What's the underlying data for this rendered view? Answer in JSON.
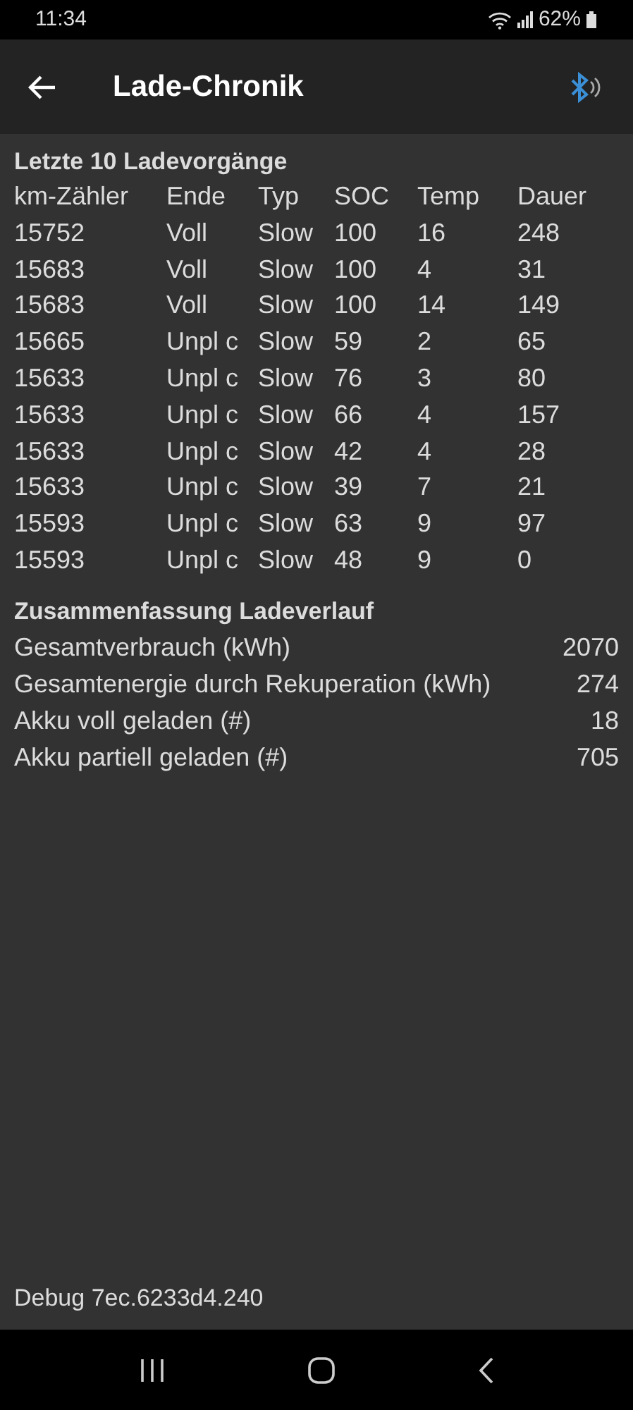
{
  "status_bar": {
    "time": "11:34",
    "battery": "62%"
  },
  "app_bar": {
    "title": "Lade-Chronik"
  },
  "history": {
    "title": "Letzte 10 Ladevorgänge",
    "columns": [
      "km-Zähler",
      "Ende",
      "Typ",
      "SOC",
      "Temp",
      "Dauer"
    ],
    "rows": [
      [
        "15752",
        "Voll",
        "Slow",
        "100",
        "16",
        "248"
      ],
      [
        "15683",
        "Voll",
        "Slow",
        "100",
        "4",
        "31"
      ],
      [
        "15683",
        "Voll",
        "Slow",
        "100",
        "14",
        "149"
      ],
      [
        "15665",
        "Unpl c",
        "Slow",
        "59",
        "2",
        "65"
      ],
      [
        "15633",
        "Unpl c",
        "Slow",
        "76",
        "3",
        "80"
      ],
      [
        "15633",
        "Unpl c",
        "Slow",
        "66",
        "4",
        "157"
      ],
      [
        "15633",
        "Unpl c",
        "Slow",
        "42",
        "4",
        "28"
      ],
      [
        "15633",
        "Unpl c",
        "Slow",
        "39",
        "7",
        "21"
      ],
      [
        "15593",
        "Unpl c",
        "Slow",
        "63",
        "9",
        "97"
      ],
      [
        "15593",
        "Unpl c",
        "Slow",
        "48",
        "9",
        "0"
      ]
    ]
  },
  "summary": {
    "title": "Zusammenfassung Ladeverlauf",
    "rows": [
      {
        "label": "Gesamtverbrauch (kWh)",
        "value": "2070"
      },
      {
        "label": "Gesamtenergie durch Rekuperation (kWh)",
        "value": "274"
      },
      {
        "label": "Akku voll geladen (#)",
        "value": "18"
      },
      {
        "label": "Akku partiell geladen (#)",
        "value": "705"
      }
    ]
  },
  "footer": {
    "debug": "Debug 7ec.6233d4.240"
  }
}
